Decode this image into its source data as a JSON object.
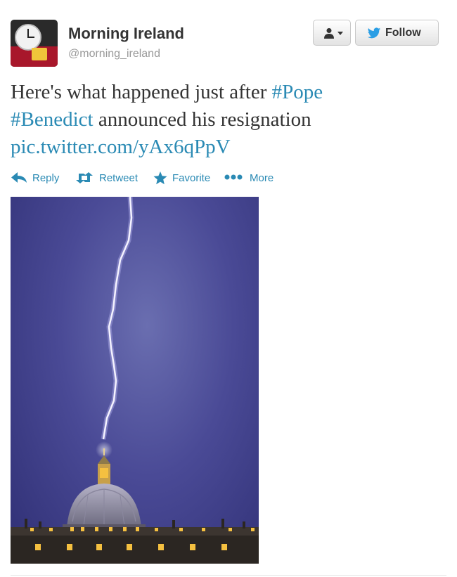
{
  "profile": {
    "name": "Morning Ireland",
    "handle": "@morning_ireland",
    "avatar_icon": "radio-clock-avatar"
  },
  "buttons": {
    "user_actions_icon": "person-icon",
    "follow_label": "Follow",
    "follow_icon": "twitter-bird-icon"
  },
  "tweet": {
    "text_1": "Here's what happened just after ",
    "hashtag_1": "#Pope",
    "hashtag_2": "#Benedict",
    "text_2": " announced his resignation",
    "link": "pic.twitter.com/yAx6qPpV"
  },
  "actions": [
    {
      "label": "Reply",
      "icon": "reply-arrow-icon"
    },
    {
      "label": "Retweet",
      "icon": "retweet-icon"
    },
    {
      "label": "Favorite",
      "icon": "star-icon"
    },
    {
      "label": "More",
      "icon": "more-dots-icon"
    }
  ],
  "colors": {
    "link": "#2a8ab4",
    "sky": "#4a4a96",
    "lightning": "#f4f2ff",
    "lights": "#f5c040"
  },
  "media": {
    "subject": "lightning-over-dome-photo"
  }
}
